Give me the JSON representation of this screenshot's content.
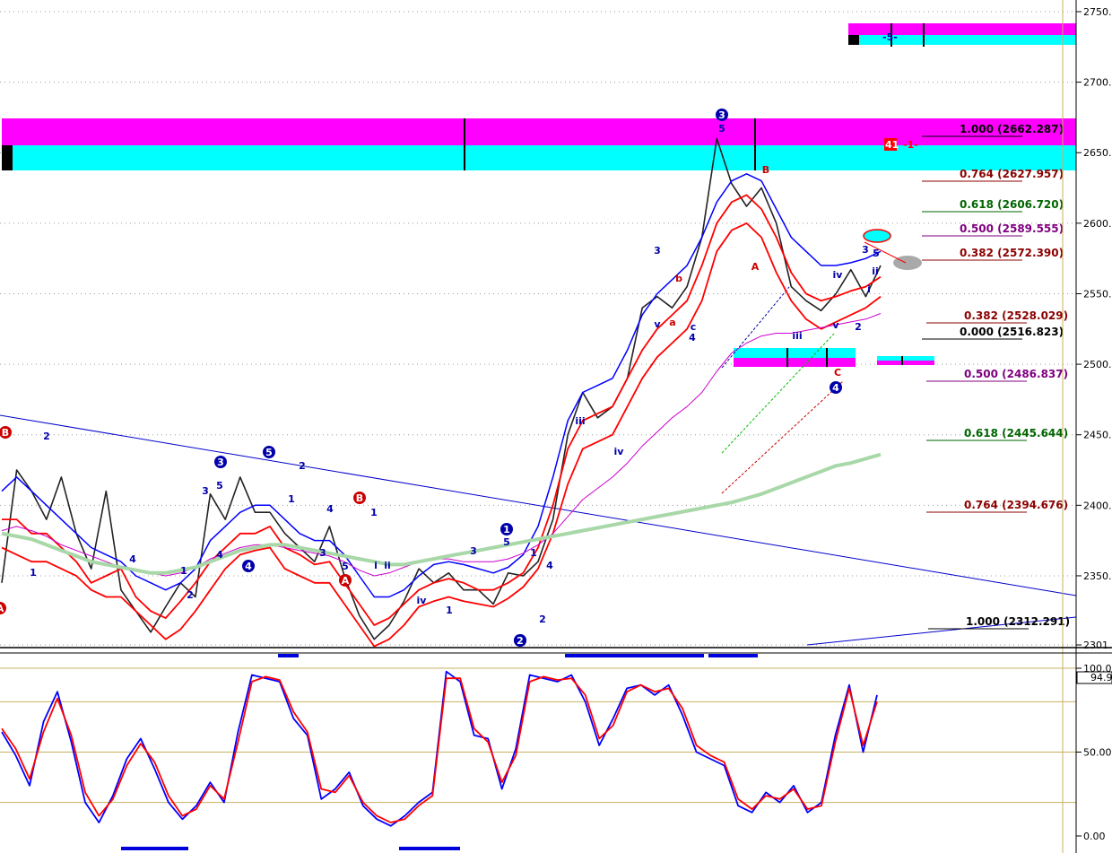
{
  "chart_data": [
    {
      "type": "line",
      "panel": "price",
      "title": "",
      "xlabel": "",
      "ylabel": "",
      "ylim": [
        2301,
        2760
      ],
      "y_ticks": [
        2750,
        2700,
        2650,
        2600,
        2550,
        2500,
        2450,
        2400,
        2350,
        2301
      ],
      "y_tick_labels": [
        "2750.",
        "2700.",
        "2650.",
        "2600.",
        "2550.",
        "2500.",
        "2450.",
        "2400.",
        "2350.",
        "2301."
      ],
      "grid": "dotted horizontal",
      "series": [
        {
          "values": [
            2345,
            2425,
            2410,
            2390,
            2420,
            2380,
            2355,
            2410,
            2340,
            2325,
            2310,
            2328,
            2345,
            2335,
            2408,
            2390,
            2420,
            2395,
            2395,
            2380,
            2370,
            2360,
            2385,
            2350,
            2322,
            2305,
            2315,
            2332,
            2355,
            2345,
            2352,
            2340,
            2340,
            2330,
            2352,
            2350,
            2360,
            2390,
            2450,
            2480,
            2462,
            2470,
            2490,
            2540,
            2548,
            2540,
            2555,
            2590,
            2660,
            2628,
            2612,
            2625,
            2600,
            2555,
            2545,
            2538,
            2550,
            2567,
            2548,
            2570
          ]
        },
        {
          "values": [
            2390,
            2390,
            2380,
            2380,
            2370,
            2360,
            2345,
            2350,
            2355,
            2335,
            2325,
            2320,
            2332,
            2345,
            2360,
            2370,
            2380,
            2380,
            2385,
            2370,
            2365,
            2358,
            2360,
            2345,
            2330,
            2315,
            2320,
            2330,
            2340,
            2345,
            2348,
            2345,
            2340,
            2340,
            2345,
            2352,
            2370,
            2400,
            2440,
            2460,
            2465,
            2470,
            2490,
            2510,
            2525,
            2535,
            2545,
            2570,
            2600,
            2615,
            2620,
            2610,
            2590,
            2565,
            2550,
            2545,
            2548,
            2552,
            2555,
            2562
          ]
        },
        {
          "values": [
            2410,
            2420,
            2410,
            2400,
            2390,
            2380,
            2370,
            2365,
            2360,
            2350,
            2345,
            2340,
            2345,
            2355,
            2375,
            2385,
            2395,
            2400,
            2400,
            2390,
            2380,
            2375,
            2375,
            2365,
            2350,
            2335,
            2335,
            2340,
            2350,
            2358,
            2360,
            2358,
            2355,
            2352,
            2356,
            2365,
            2385,
            2420,
            2460,
            2480,
            2485,
            2490,
            2510,
            2535,
            2550,
            2560,
            2570,
            2590,
            2615,
            2630,
            2635,
            2630,
            2610,
            2590,
            2580,
            2570,
            2570,
            2572,
            2575,
            2580
          ]
        },
        {
          "values": [
            2370,
            2365,
            2360,
            2360,
            2355,
            2350,
            2340,
            2335,
            2335,
            2325,
            2315,
            2305,
            2312,
            2325,
            2340,
            2355,
            2365,
            2368,
            2370,
            2355,
            2350,
            2345,
            2345,
            2330,
            2315,
            2300,
            2305,
            2315,
            2328,
            2332,
            2335,
            2332,
            2330,
            2328,
            2334,
            2342,
            2355,
            2380,
            2415,
            2440,
            2445,
            2450,
            2470,
            2490,
            2505,
            2515,
            2525,
            2545,
            2580,
            2595,
            2600,
            2590,
            2565,
            2545,
            2532,
            2525,
            2530,
            2535,
            2540,
            2548
          ]
        },
        {
          "values": [
            2382,
            2385,
            2382,
            2378,
            2372,
            2368,
            2364,
            2360,
            2356,
            2354,
            2352,
            2350,
            2352,
            2356,
            2362,
            2366,
            2370,
            2372,
            2372,
            2370,
            2368,
            2366,
            2364,
            2360,
            2354,
            2350,
            2352,
            2356,
            2360,
            2362,
            2362,
            2360,
            2360,
            2360,
            2362,
            2366,
            2372,
            2380,
            2392,
            2404,
            2412,
            2420,
            2430,
            2442,
            2452,
            2462,
            2470,
            2480,
            2495,
            2508,
            2515,
            2520,
            2522,
            2522,
            2524,
            2526,
            2528,
            2530,
            2532,
            2536
          ]
        },
        {
          "values": [
            2380,
            2378,
            2376,
            2372,
            2368,
            2364,
            2360,
            2358,
            2356,
            2354,
            2352,
            2352,
            2354,
            2356,
            2360,
            2364,
            2368,
            2370,
            2372,
            2372,
            2370,
            2368,
            2366,
            2364,
            2362,
            2360,
            2358,
            2358,
            2360,
            2362,
            2364,
            2366,
            2368,
            2370,
            2372,
            2374,
            2376,
            2378,
            2380,
            2382,
            2384,
            2386,
            2388,
            2390,
            2392,
            2394,
            2396,
            2398,
            2400,
            2402,
            2405,
            2408,
            2412,
            2416,
            2420,
            2424,
            2428,
            2430,
            2433,
            2436
          ]
        }
      ],
      "fib_levels": [
        {
          "label": "1.000 (2662.287)",
          "color": "#000000"
        },
        {
          "label": "0.764 (2627.957)",
          "color": "#8b0000"
        },
        {
          "label": "0.618 (2606.720)",
          "color": "#006400"
        },
        {
          "label": "0.500 (2589.555)",
          "color": "#800080"
        },
        {
          "label": "0.382 (2572.390)",
          "color": "#8b0000"
        },
        {
          "label": "0.382 (2528.029)",
          "color": "#8b0000"
        },
        {
          "label": "0.000 (2516.823)",
          "color": "#000000"
        },
        {
          "label": "0.500 (2486.837)",
          "color": "#800080"
        },
        {
          "label": "0.618 (2445.644)",
          "color": "#006400"
        },
        {
          "label": "0.764 (2394.676)",
          "color": "#8b0000"
        },
        {
          "label": "1.000 (2312.291)",
          "color": "#000000"
        }
      ],
      "wave_labels": {
        "circled": [
          "B",
          "2",
          "3",
          "5",
          "4",
          "B",
          "A",
          "1",
          "2",
          "3",
          "4",
          "A"
        ],
        "plain": [
          "2",
          "1",
          "4",
          "1",
          "2",
          "3",
          "5",
          "4",
          "2",
          "1",
          "3",
          "4",
          "5",
          "i",
          "1",
          "ii",
          "iv",
          "3",
          "5",
          "1",
          "2",
          "iii",
          "iv",
          "3",
          "v",
          "b",
          "a",
          "c",
          "4",
          "5",
          "B",
          "A",
          "C",
          "iii",
          "v",
          "iv",
          "3",
          "5",
          "2",
          "i",
          "ii",
          "4",
          "1"
        ]
      },
      "box_labels": [
        "-5-",
        "41",
        "-1-"
      ]
    },
    {
      "type": "line",
      "panel": "oscillator",
      "ylim": [
        0,
        100
      ],
      "y_ticks": [
        100,
        50,
        0
      ],
      "y_tick_labels": [
        "100.0",
        "50.00",
        "0.00"
      ],
      "current_value_label": "94.9",
      "series": [
        {
          "values": [
            62,
            48,
            30,
            68,
            86,
            56,
            20,
            8,
            24,
            46,
            58,
            40,
            20,
            10,
            18,
            32,
            20,
            62,
            96,
            94,
            92,
            70,
            60,
            22,
            28,
            38,
            18,
            10,
            6,
            12,
            20,
            26,
            98,
            92,
            60,
            58,
            28,
            52,
            96,
            94,
            92,
            96,
            80,
            54,
            70,
            88,
            90,
            84,
            90,
            72,
            50,
            46,
            42,
            18,
            14,
            26,
            20,
            30,
            14,
            20,
            60,
            90,
            50,
            84
          ]
        },
        {
          "values": [
            64,
            52,
            34,
            62,
            82,
            60,
            26,
            12,
            22,
            42,
            55,
            44,
            24,
            12,
            16,
            30,
            22,
            56,
            92,
            95,
            93,
            74,
            62,
            28,
            26,
            36,
            20,
            12,
            8,
            10,
            18,
            24,
            94,
            94,
            64,
            56,
            32,
            48,
            92,
            95,
            93,
            94,
            84,
            58,
            66,
            86,
            90,
            86,
            88,
            76,
            54,
            48,
            44,
            22,
            16,
            24,
            22,
            28,
            16,
            18,
            56,
            88,
            54,
            80
          ]
        }
      ]
    }
  ]
}
